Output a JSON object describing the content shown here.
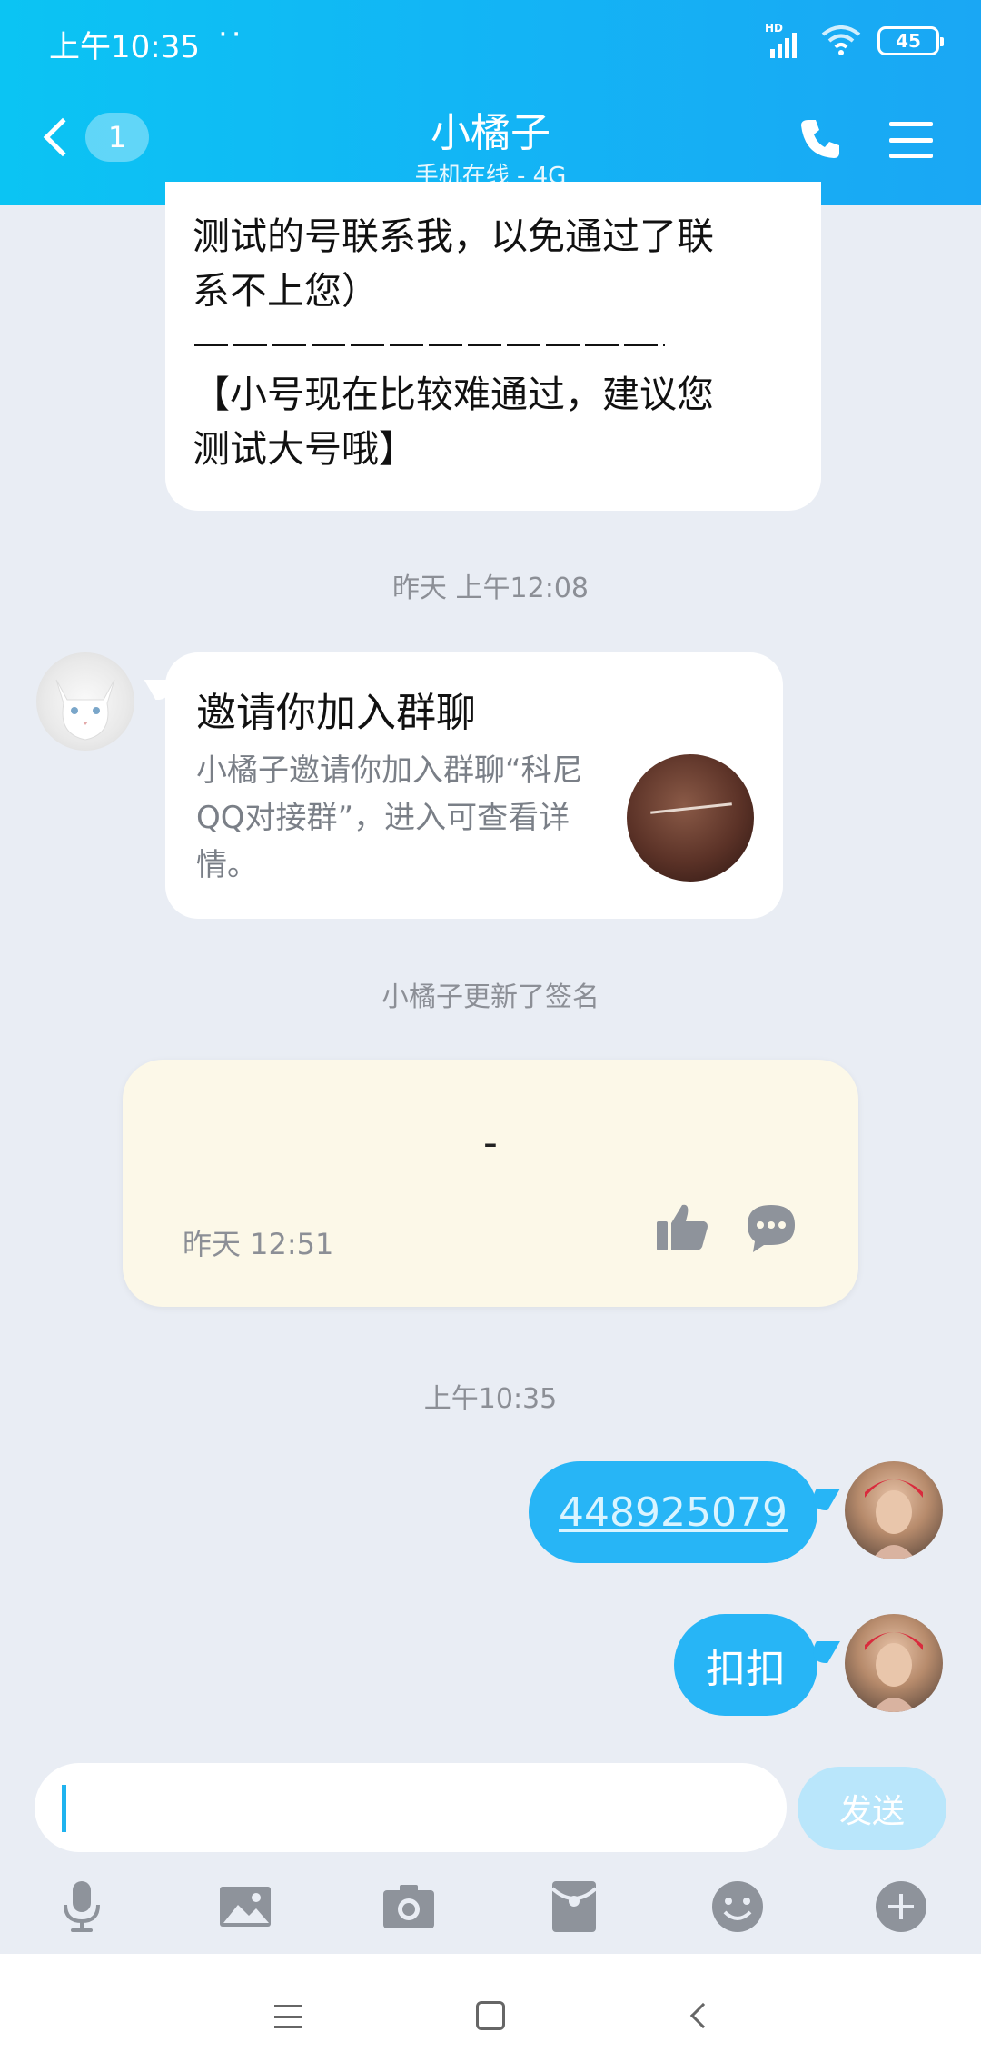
{
  "status": {
    "time": "上午10:35",
    "dots": "··",
    "battery": "45",
    "hd": "HD"
  },
  "header": {
    "unread": "1",
    "title": "小橘子",
    "subtitle": "手机在线 - 4G"
  },
  "messages": {
    "top_lines": [
      "测试的号联系我，以免通过了联",
      "系不上您）",
      "——————————————————",
      "【小号现在比较难通过，建议您",
      "测试大号哦】"
    ],
    "time1": "昨天 上午12:08",
    "invite": {
      "title": "邀请你加入群聊",
      "desc": "小橘子邀请你加入群聊“科尼QQ对接群”，进入可查看详情。"
    },
    "sys_signature": "小橘子更新了签名",
    "signature": {
      "text": "-",
      "time": "昨天 12:51"
    },
    "time2": "上午10:35",
    "mine": [
      "448925079",
      "扣扣"
    ]
  },
  "composer": {
    "send_label": "发送"
  },
  "colors": {
    "header_start": "#0bc4f3",
    "header_end": "#1aa7f4",
    "bubble_blue": "#27b5f6",
    "page_bg": "#e9edf4",
    "card_yellow": "#fcf8e8"
  },
  "icons": [
    "microphone-icon",
    "image-icon",
    "camera-icon",
    "red-packet-icon",
    "emoji-icon",
    "plus-icon"
  ]
}
